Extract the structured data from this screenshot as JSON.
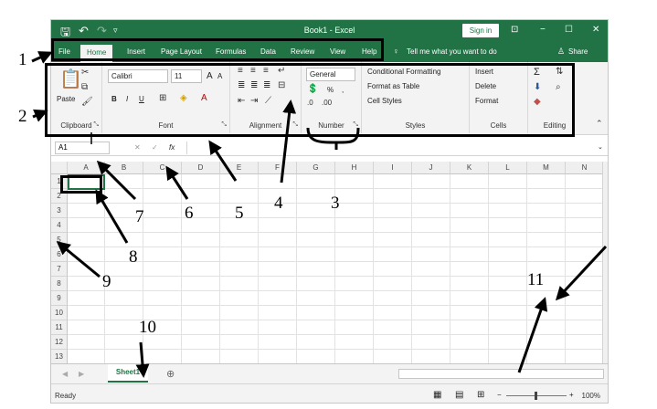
{
  "titlebar": {
    "doc_title": "Book1 - Excel",
    "sign_in": "Sign in",
    "save_icon": "save-icon",
    "undo_icon": "undo-icon",
    "redo_icon": "redo-icon",
    "minimize": "−",
    "restore": "☐",
    "close": "✕"
  },
  "tabs": [
    "File",
    "Home",
    "Insert",
    "Page Layout",
    "Formulas",
    "Data",
    "Review",
    "View",
    "Help"
  ],
  "tell_me": "Tell me what you want to do",
  "share": "Share",
  "ribbon": {
    "clipboard": {
      "label": "Clipboard",
      "paste": "Paste"
    },
    "font": {
      "label": "Font",
      "font_name": "Calibri",
      "font_size": "11",
      "bold": "B",
      "italic": "I",
      "underline": "U",
      "grow": "A",
      "shrink": "A"
    },
    "alignment": {
      "label": "Alignment"
    },
    "number": {
      "label": "Number",
      "format": "General",
      "percent": "%",
      "comma": ","
    },
    "styles": {
      "label": "Styles",
      "conditional": "Conditional Formatting",
      "format_table": "Format as Table",
      "cell_styles": "Cell Styles"
    },
    "cells": {
      "label": "Cells",
      "insert": "Insert",
      "delete": "Delete",
      "format": "Format"
    },
    "editing": {
      "label": "Editing",
      "sum": "Σ"
    }
  },
  "formula_bar": {
    "name_box": "A1",
    "cancel": "✕",
    "enter": "✓",
    "fx": "fx"
  },
  "columns": [
    "A",
    "B",
    "C",
    "D",
    "E",
    "F",
    "G",
    "H",
    "I",
    "J",
    "K",
    "L",
    "M",
    "N"
  ],
  "rows": [
    "1",
    "2",
    "3",
    "4",
    "5",
    "6",
    "7",
    "8",
    "9",
    "10",
    "11",
    "12",
    "13"
  ],
  "sheet_tab": "Sheet1",
  "add_sheet": "⊕",
  "status": {
    "ready": "Ready",
    "zoom": "100%",
    "zoom_minus": "−",
    "zoom_plus": "+"
  },
  "callouts": [
    "1",
    "2",
    "3",
    "4",
    "5",
    "6",
    "7",
    "8",
    "9",
    "10",
    "11"
  ]
}
